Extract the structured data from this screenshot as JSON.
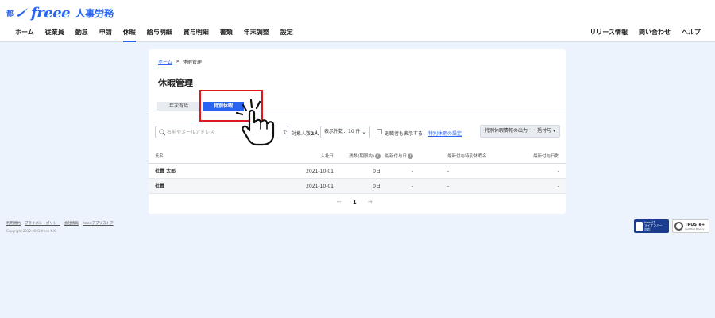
{
  "header": {
    "logo_mark": "都",
    "logo_brand": "freee",
    "logo_product": "人事労務",
    "nav": [
      "ホーム",
      "従業員",
      "勤怠",
      "申請",
      "休暇",
      "給与明細",
      "賞与明細",
      "書類",
      "年末調整",
      "設定"
    ],
    "active_nav": "休暇",
    "nav_right": [
      "リリース情報",
      "問い合わせ",
      "ヘルプ"
    ]
  },
  "breadcrumb": {
    "home": "ホーム",
    "separator": ">",
    "current": "休暇管理"
  },
  "page_title": "休暇管理",
  "tabs": {
    "annual": "年次有給",
    "special": "特別休暇"
  },
  "toolbar": {
    "search_placeholder": "名前やメールアドレス",
    "search_suffix": "で",
    "target_count_label": "対象人数",
    "target_count_value": "2人",
    "page_size_label": "表示件数：10 件",
    "show_retired_label": "退職者も表示する",
    "settings_link": "特別休暇の設定",
    "export_button": "特別休暇情報の出力・一括付与 ▾"
  },
  "table": {
    "headers": {
      "name": "氏名",
      "join_date": "入社日",
      "remaining": "残数(期限内)",
      "last_grant_date": "最新付与日",
      "last_special_name": "最新付与特別休暇名",
      "last_grant_days": "最新付与日数"
    },
    "rows": [
      {
        "name": "社員 太郎",
        "join_date": "2021-10-01",
        "remaining": "0日",
        "last_grant_date": "-",
        "last_special_name": "-",
        "last_grant_days": "-"
      },
      {
        "name": "社員",
        "join_date": "2021-10-01",
        "remaining": "0日",
        "last_grant_date": "-",
        "last_special_name": "-",
        "last_grant_days": "-"
      }
    ]
  },
  "pager": {
    "prev": "←",
    "current": "1",
    "next": "→"
  },
  "footer": {
    "links": [
      "利用規約",
      "プライバシーポリシー",
      "会社情報",
      "freeeアプリストア"
    ],
    "copyright": "Copyright 2012-2022 freee K.K."
  },
  "badges": {
    "mynumber": [
      "freeeは",
      "マイナンバー",
      "対応"
    ],
    "truste": [
      "TRUSTe+",
      "Certified Privacy"
    ]
  },
  "colors": {
    "accent": "#2864f0",
    "highlight": "#e0161f",
    "background": "#edf3fc"
  }
}
